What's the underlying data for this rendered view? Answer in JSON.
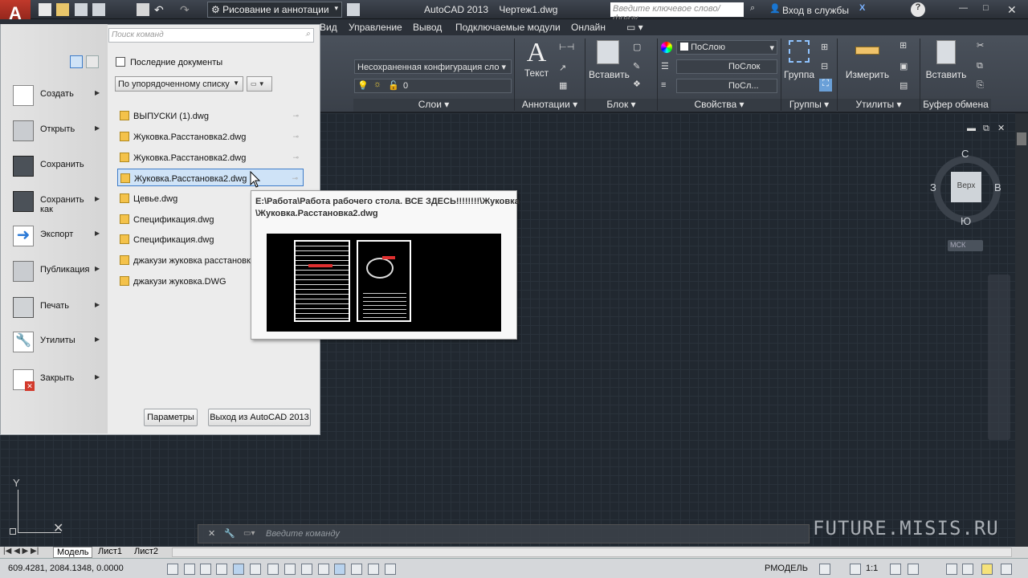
{
  "titlebar": {
    "workspace": "Рисование и аннотации",
    "title": "AutoCAD 2013    Чертеж1.dwg",
    "search_placeholder": "Введите ключевое слово/фразу",
    "signin": "Вход в службы"
  },
  "menubar": {
    "items": [
      "Вид",
      "Управление",
      "Вывод",
      "Подключаемые модули",
      "Онлайн"
    ]
  },
  "ribbon": {
    "layer_state": "Несохраненная конфигурация сло",
    "layer_current": "0",
    "prop_color": "ПоСлою",
    "prop_linetype": "ПоСлок",
    "prop_lineweight": "ПоСл...",
    "text_label": "Текст",
    "insert_label": "Вставить",
    "group_label": "Группа",
    "measure_label": "Измерить",
    "paste_label": "Вставить",
    "panels": {
      "layers": "Слои ▾",
      "annotations": "Аннотации ▾",
      "block": "Блок ▾",
      "properties": "Свойства ▾",
      "groups": "Группы ▾",
      "utilities": "Утилиты ▾",
      "clipboard": "Буфер обмена"
    }
  },
  "appmenu": {
    "search_placeholder": "Поиск команд",
    "recent_header": "Последние документы",
    "sort_option": "По упорядоченному списку",
    "left_items": [
      {
        "label": "Создать",
        "icon": "new-document-icon"
      },
      {
        "label": "Открыть",
        "icon": "open-folder-icon"
      },
      {
        "label": "Сохранить",
        "icon": "save-disk-icon"
      },
      {
        "label": "Сохранить как",
        "icon": "save-as-icon"
      },
      {
        "label": "Экспорт",
        "icon": "export-arrow-icon"
      },
      {
        "label": "Публикация",
        "icon": "publish-icon"
      },
      {
        "label": "Печать",
        "icon": "printer-icon"
      },
      {
        "label": "Утилиты",
        "icon": "wrench-icon"
      },
      {
        "label": "Закрыть",
        "icon": "close-document-icon"
      }
    ],
    "recent_docs": [
      "ВЫПУСКИ (1).dwg",
      "Жуковка.Расстановка2.dwg",
      "Жуковка.Расстановка2.dwg",
      "Жуковка.Расстановка2.dwg",
      "Цевье.dwg",
      "Спецификация.dwg",
      "Спецификация.dwg",
      "джакузи жуковка расстановк",
      "джакузи жуковка.DWG"
    ],
    "params_button": "Параметры",
    "exit_button": "Выход из AutoCAD 2013"
  },
  "tooltip": {
    "path_line1": "E:\\Работа\\Работа рабочего стола. ВСЕ ЗДЕСЬ!!!!!!!!\\Жуковка",
    "path_line2": "\\Жуковка.Расстановка2.dwg"
  },
  "navcube": {
    "north": "С",
    "south": "Ю",
    "west": "З",
    "east": "В",
    "face": "Верх",
    "ucs": "МСК"
  },
  "command": {
    "placeholder": "Введите команду"
  },
  "tabs": [
    "Модель",
    "Лист1",
    "Лист2"
  ],
  "status": {
    "coords": "609.4281, 2084.1348, 0.0000",
    "mode": "РМОДЕЛЬ",
    "scale": "1:1"
  },
  "watermark": "FUTURE.MISIS.RU",
  "colors": {
    "accent": "#3d7cc9",
    "canvas": "#212830",
    "selected": "#cfe3f7"
  }
}
